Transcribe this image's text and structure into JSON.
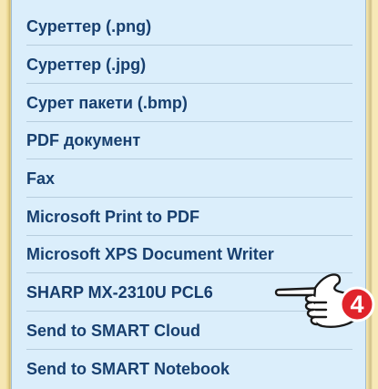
{
  "menu": {
    "items": [
      {
        "label": "Суреттер (.png)"
      },
      {
        "label": "Суреттер (.jpg)"
      },
      {
        "label": "Сурет пакети (.bmp)"
      },
      {
        "label": "PDF документ"
      },
      {
        "label": "Fax"
      },
      {
        "label": "Microsoft Print to PDF"
      },
      {
        "label": "Microsoft XPS Document Writer"
      },
      {
        "label": "SHARP MX-2310U PCL6"
      },
      {
        "label": "Send to SMART Cloud"
      },
      {
        "label": "Send to SMART Notebook"
      }
    ]
  },
  "callout": {
    "step_number": "4",
    "icon": "pointing-hand-icon",
    "badge_color": "#e0242b"
  }
}
